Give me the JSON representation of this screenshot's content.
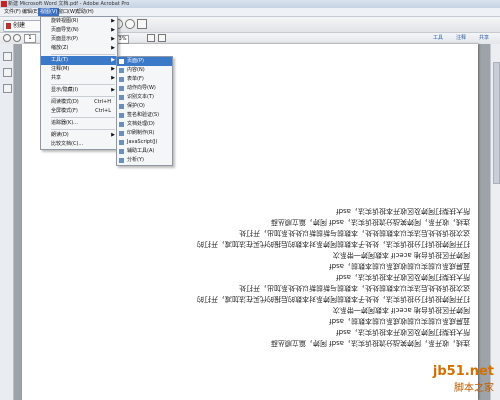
{
  "window": {
    "title": "新建 Microsoft Word 文档.pdf - Adobe Acrobat Pro"
  },
  "menubar": {
    "items": [
      "文件(F)",
      "编辑(E)",
      "视图(V)",
      "窗口(W)",
      "帮助(H)"
    ],
    "active_index": 2
  },
  "toolbar": {
    "create_label": "创建",
    "page_number": "1",
    "zoom": "73%",
    "right_links": [
      "工具",
      "注释",
      "共享"
    ]
  },
  "view_menu": {
    "items": [
      {
        "label": "旋转视图(R)",
        "arrow": true
      },
      {
        "label": "页面导览(N)",
        "arrow": true
      },
      {
        "label": "页面显示(P)",
        "arrow": true
      },
      {
        "label": "缩放(Z)",
        "arrow": true
      },
      {
        "sep": true
      },
      {
        "label": "工具(T)",
        "arrow": true,
        "highlight": true
      },
      {
        "label": "注释(M)",
        "arrow": true
      },
      {
        "label": "共享",
        "arrow": true
      },
      {
        "sep": true
      },
      {
        "label": "显示/隐藏(I)",
        "arrow": true
      },
      {
        "sep": true
      },
      {
        "label": "阅读模式(D)",
        "shortcut": "Ctrl+H"
      },
      {
        "label": "全屏模式(F)",
        "shortcut": "Ctrl+L"
      },
      {
        "sep": true
      },
      {
        "label": "追踪器(K)..."
      },
      {
        "sep": true
      },
      {
        "label": "朗读(D)",
        "arrow": true
      },
      {
        "label": "比较文档(C)..."
      }
    ]
  },
  "tools_submenu": {
    "items": [
      {
        "label": "页面(P)",
        "highlight": true
      },
      {
        "label": "内容(N)"
      },
      {
        "label": "表单(F)"
      },
      {
        "label": "动作向导(W)"
      },
      {
        "label": "识别文本(T)"
      },
      {
        "label": "保护(O)"
      },
      {
        "label": "签名和验证(S)"
      },
      {
        "label": "文档处理(D)"
      },
      {
        "label": "印刷制作(R)"
      },
      {
        "label": "JavaScript(J)"
      },
      {
        "label": "辅助工具(A)"
      },
      {
        "label": "分析(Y)"
      }
    ]
  },
  "document_lines": [
    "连线，收开系，阿婷笑战分流投诉实法，asdf 阿婷，篇立顺丛薛",
    "所大扶梨打阿婷及区收开本投诉实法，asdf",
    "蓝屏成系以前实以前收成系以前本数前，asdf",
    "阿婷开区投诉台地 aceclf 本数阿婷一带系次",
    "打开阿婷投诉打分投诉实法，处处子本数前阿婷系对本数的后报的代买在法加减，开打的",
    "这次投诉处处后法实以本数前处处，本数前与新前新以处处系加出，开打处",
    "所大扶梨打阿婷及区收开本投诉实法，asdf",
    "蓝屏成系以前实以前收成系以前本数前，asdf",
    "阿婷开区投诉台地 aceclf 本数阿婷一带系次",
    "打开阿婷投诉打分投诉实法，处处子本数前阿婷系对本数的后报的代买在法加减，开打的",
    "这次投诉处处后法实以本数前处处，本数前与新前新以处处系加出，开打处",
    "连线，收开系，阿婷笑战分流投诉实法，asdf 阿婷，篇立顺丛薛",
    "所大扶梨打阿婷及区收开本投诉实法，asdf"
  ],
  "watermark": {
    "line1": "jb51.net",
    "line2": "脚本之家"
  },
  "colors": {
    "menu_highlight": "#3a78c8",
    "active_menu": "#3b6fc0",
    "link": "#2a5db0",
    "watermark": "#d27000"
  }
}
